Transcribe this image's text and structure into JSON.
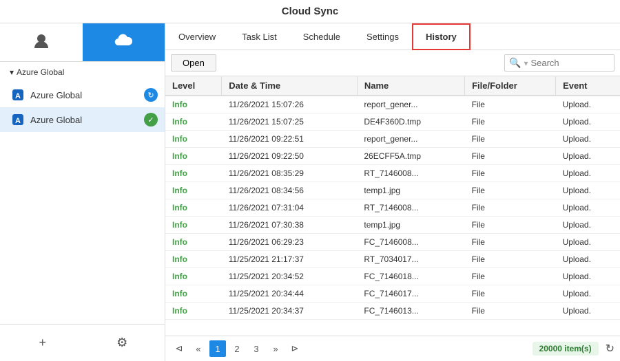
{
  "app": {
    "title": "Cloud Sync"
  },
  "sidebar": {
    "section_label": "Azure Global",
    "items": [
      {
        "id": "azure-global-1",
        "label": "Azure Global",
        "badge_type": "blue",
        "badge_icon": "↻"
      },
      {
        "id": "azure-global-2",
        "label": "Azure Global",
        "badge_type": "green",
        "badge_icon": "✓"
      }
    ],
    "add_label": "+",
    "settings_label": "⚙"
  },
  "tabs": [
    {
      "id": "overview",
      "label": "Overview"
    },
    {
      "id": "task-list",
      "label": "Task List"
    },
    {
      "id": "schedule",
      "label": "Schedule"
    },
    {
      "id": "settings",
      "label": "Settings"
    },
    {
      "id": "history",
      "label": "History",
      "active": true
    }
  ],
  "toolbar": {
    "open_label": "Open",
    "search_placeholder": "Search"
  },
  "table": {
    "columns": [
      "Level",
      "Date & Time",
      "Name",
      "File/Folder",
      "Event"
    ],
    "rows": [
      {
        "level": "Info",
        "datetime": "11/26/2021 15:07:26",
        "name": "report_gener...",
        "filefolder": "File",
        "event": "Upload."
      },
      {
        "level": "Info",
        "datetime": "11/26/2021 15:07:25",
        "name": "DE4F360D.tmp",
        "filefolder": "File",
        "event": "Upload."
      },
      {
        "level": "Info",
        "datetime": "11/26/2021 09:22:51",
        "name": "report_gener...",
        "filefolder": "File",
        "event": "Upload."
      },
      {
        "level": "Info",
        "datetime": "11/26/2021 09:22:50",
        "name": "26ECFF5A.tmp",
        "filefolder": "File",
        "event": "Upload."
      },
      {
        "level": "Info",
        "datetime": "11/26/2021 08:35:29",
        "name": "RT_7146008...",
        "filefolder": "File",
        "event": "Upload."
      },
      {
        "level": "Info",
        "datetime": "11/26/2021 08:34:56",
        "name": "temp1.jpg",
        "filefolder": "File",
        "event": "Upload."
      },
      {
        "level": "Info",
        "datetime": "11/26/2021 07:31:04",
        "name": "RT_7146008...",
        "filefolder": "File",
        "event": "Upload."
      },
      {
        "level": "Info",
        "datetime": "11/26/2021 07:30:38",
        "name": "temp1.jpg",
        "filefolder": "File",
        "event": "Upload."
      },
      {
        "level": "Info",
        "datetime": "11/26/2021 06:29:23",
        "name": "FC_7146008...",
        "filefolder": "File",
        "event": "Upload."
      },
      {
        "level": "Info",
        "datetime": "11/25/2021 21:17:37",
        "name": "RT_7034017...",
        "filefolder": "File",
        "event": "Upload."
      },
      {
        "level": "Info",
        "datetime": "11/25/2021 20:34:52",
        "name": "FC_7146018...",
        "filefolder": "File",
        "event": "Upload."
      },
      {
        "level": "Info",
        "datetime": "11/25/2021 20:34:44",
        "name": "FC_7146017...",
        "filefolder": "File",
        "event": "Upload."
      },
      {
        "level": "Info",
        "datetime": "11/25/2021 20:34:37",
        "name": "FC_7146013...",
        "filefolder": "File",
        "event": "Upload."
      }
    ]
  },
  "pagination": {
    "first_label": "⊲",
    "prev_label": "«",
    "pages": [
      "1",
      "2",
      "3"
    ],
    "next_label": "»",
    "last_label": "⊳",
    "active_page": "1",
    "items_count": "20000 item(s)"
  }
}
